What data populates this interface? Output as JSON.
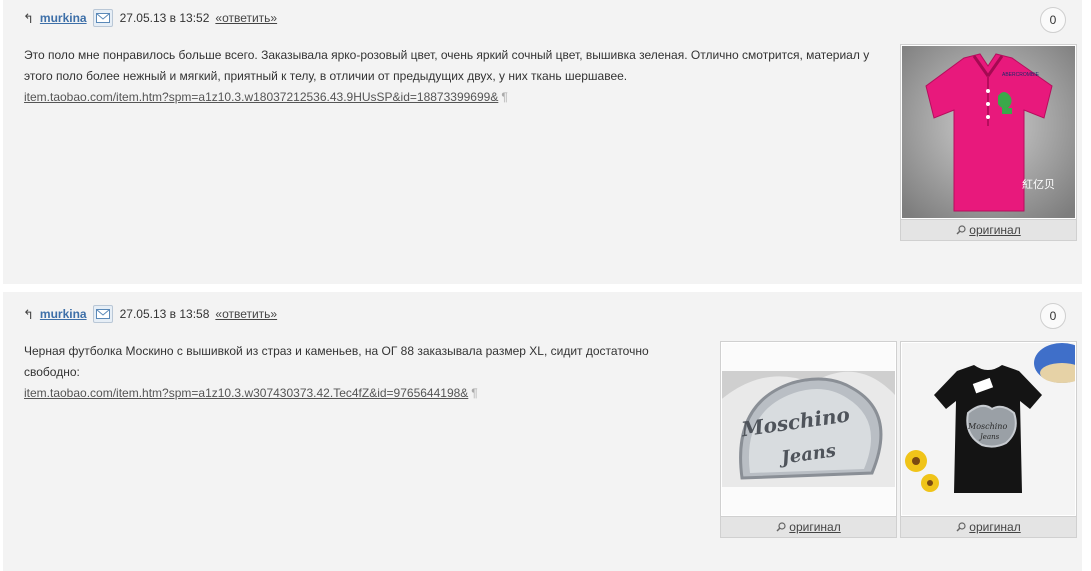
{
  "comments": [
    {
      "username": "murkina",
      "datetime": "27.05.13 в 13:52",
      "reply_label": "«ответить»",
      "rating": "0",
      "text_line1": "Это поло мне понравилось больше всего. Заказывала ярко-розовый цвет, очень яркий сочный цвет, вышивка зеленая. Отлично смотрится, материал у",
      "text_line2": "этого поло более нежный и мягкий, приятный к телу, в отличии от предыдущих двух, у них ткань шершавее.",
      "link": "item.taobao.com/item.htm?spm=a1z10.3.w18037212536.43.9HUsSP&id=18873399699&",
      "pilcrow": "¶",
      "images": [
        {
          "caption": "оригинал",
          "watermark": "紅亿贝"
        }
      ]
    },
    {
      "username": "murkina",
      "datetime": "27.05.13 в 13:58",
      "reply_label": "«ответить»",
      "rating": "0",
      "text_line1": "Черная футболка Москино с вышивкой из страз и каменьев, на ОГ 88 заказывала размер XL, сидит достаточно",
      "text_line2": "свободно:",
      "link": "item.taobao.com/item.htm?spm=a1z10.3.w307430373.42.Tec4fZ&id=9765644198&",
      "pilcrow": "¶",
      "images": [
        {
          "caption": "оригинал",
          "print_line1": "Moschino",
          "print_line2": "Jeans"
        },
        {
          "caption": "оригинал",
          "print_line1": "Moschino",
          "print_line2": "Jeans"
        }
      ]
    }
  ],
  "icons": [
    "reply-arrow-icon",
    "mail-icon",
    "magnifier-icon"
  ],
  "colors": {
    "username": "#3d6fa8",
    "comment_bg": "#f3f3f3",
    "polo_pink": "#e8197c"
  }
}
